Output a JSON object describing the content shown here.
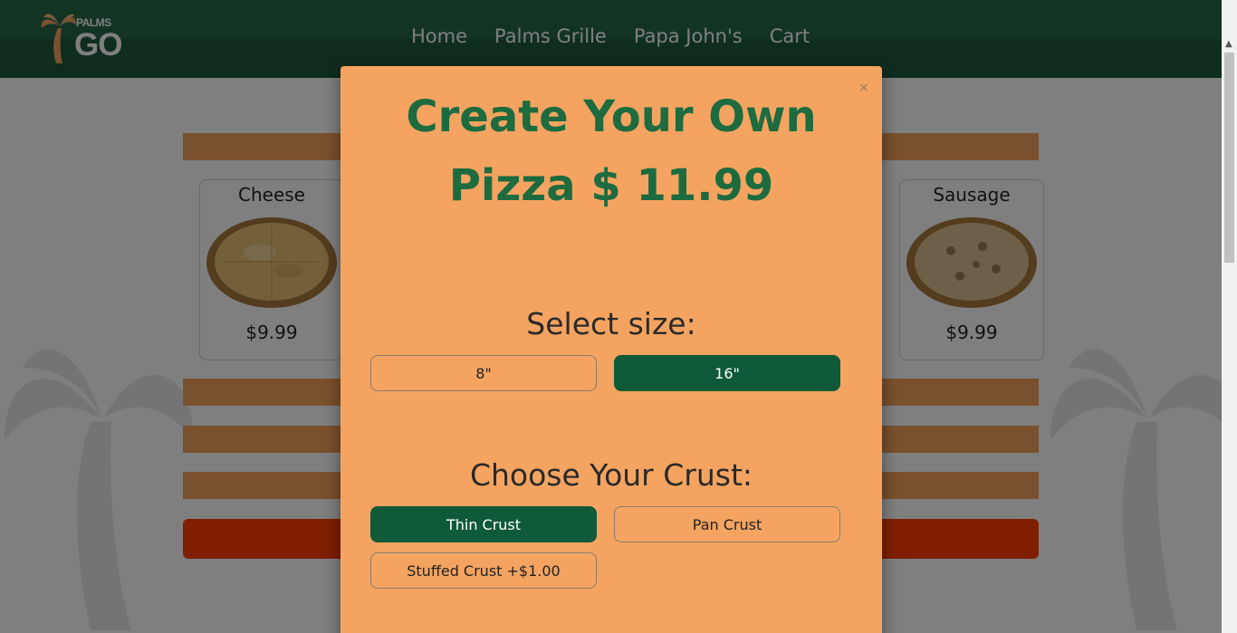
{
  "nav": {
    "logo_top": "PALMS",
    "logo_bottom": "GO",
    "links": [
      "Home",
      "Palms Grille",
      "Papa John's",
      "Cart"
    ]
  },
  "menu": {
    "cards": [
      {
        "name": "Cheese",
        "price": "$9.99"
      },
      {
        "name": "Sausage",
        "price": "$9.99"
      }
    ]
  },
  "modal": {
    "close": "×",
    "title_line1": "Create Your Own",
    "title_line2": "Pizza $ 11.99",
    "size_heading": "Select size:",
    "sizes": [
      "8\"",
      "16\""
    ],
    "selected_size": "16\"",
    "crust_heading": "Choose Your Crust:",
    "crusts": [
      "Thin Crust",
      "Pan Crust",
      "Stuffed Crust +$1.00"
    ],
    "selected_crust": "Thin Crust"
  },
  "colors": {
    "nav_green": "#26684a",
    "accent_orange": "#f4a460",
    "selected_green": "#0f5a39",
    "title_green": "#1d6b3f",
    "checkout_red": "#ff3f00"
  }
}
